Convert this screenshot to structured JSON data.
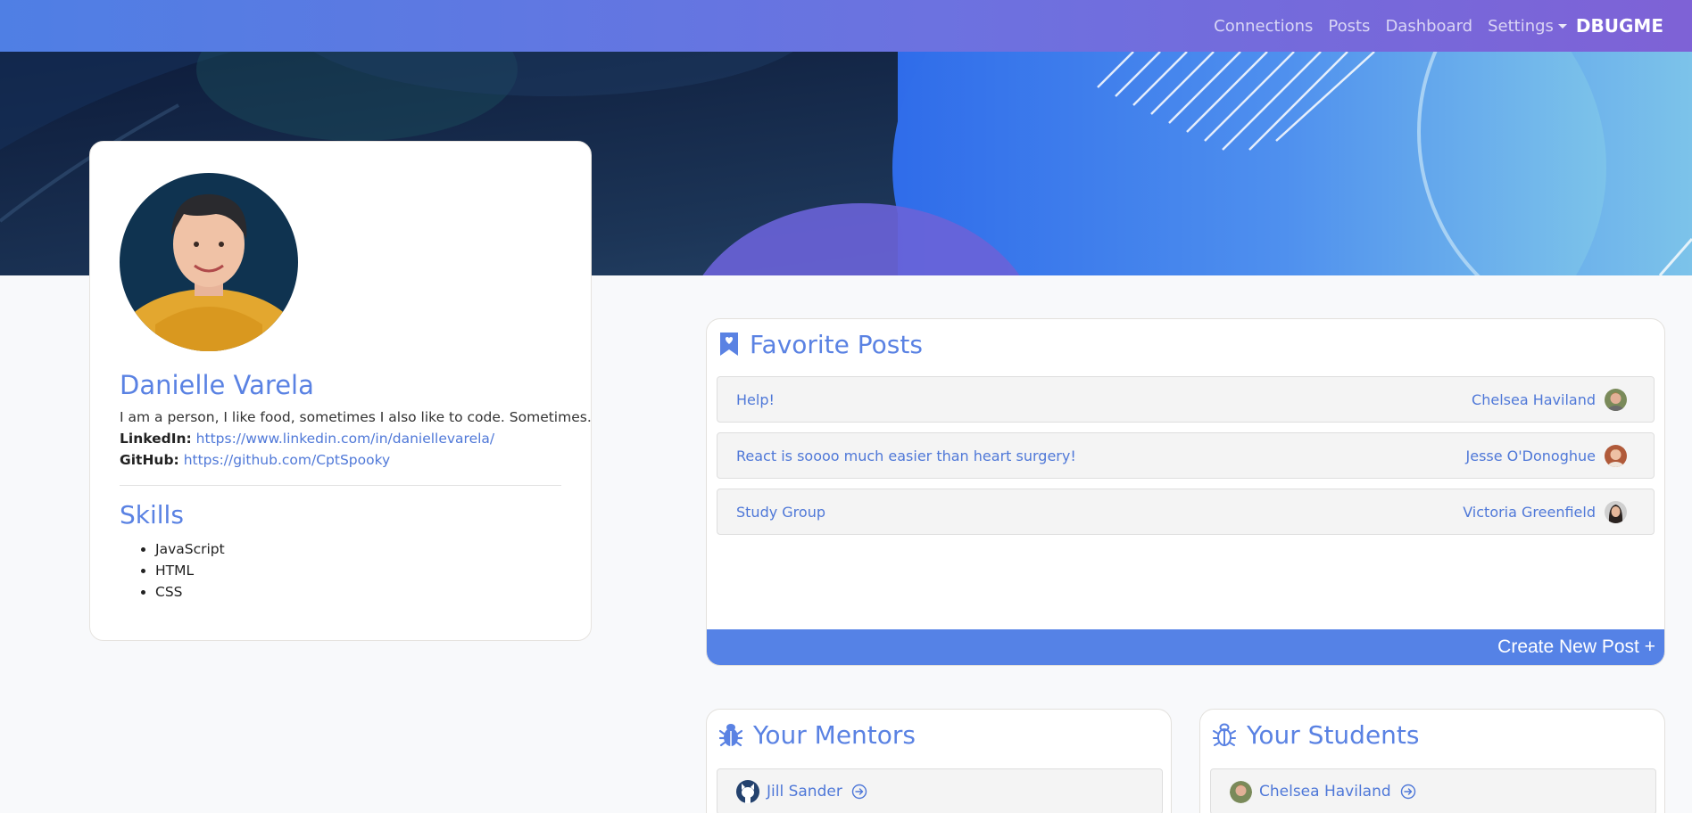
{
  "nav": {
    "links": [
      "Connections",
      "Posts",
      "Dashboard",
      "Settings"
    ],
    "brand": "DBUGME"
  },
  "profile": {
    "name": "Danielle Varela",
    "bio": "I am a person, I like food, sometimes I also like to code. Sometimes.",
    "linkedin_label": "LinkedIn:",
    "linkedin_url": "https://www.linkedin.com/in/daniellevarela/",
    "github_label": "GitHub:",
    "github_url": "https://github.com/CptSpooky",
    "skills_title": "Skills",
    "skills": [
      "JavaScript",
      "HTML",
      "CSS"
    ]
  },
  "favorite_posts": {
    "title": "Favorite Posts",
    "icon": "bookmark-heart-icon",
    "posts": [
      {
        "title": "Help!",
        "author": "Chelsea Haviland"
      },
      {
        "title": "React is soooo much easier than heart surgery!",
        "author": "Jesse O'Donoghue"
      },
      {
        "title": "Study Group",
        "author": "Victoria Greenfield"
      }
    ],
    "create_label": "Create New Post +"
  },
  "mentors": {
    "title": "Your Mentors",
    "icon": "bug-icon",
    "people": [
      {
        "name": "Jill Sander"
      }
    ]
  },
  "students": {
    "title": "Your Students",
    "icon": "bug-outline-icon",
    "people": [
      {
        "name": "Chelsea Haviland"
      }
    ]
  },
  "colors": {
    "accent": "#5582e6",
    "link": "#4f78d8",
    "heading": "#5a82e3"
  }
}
